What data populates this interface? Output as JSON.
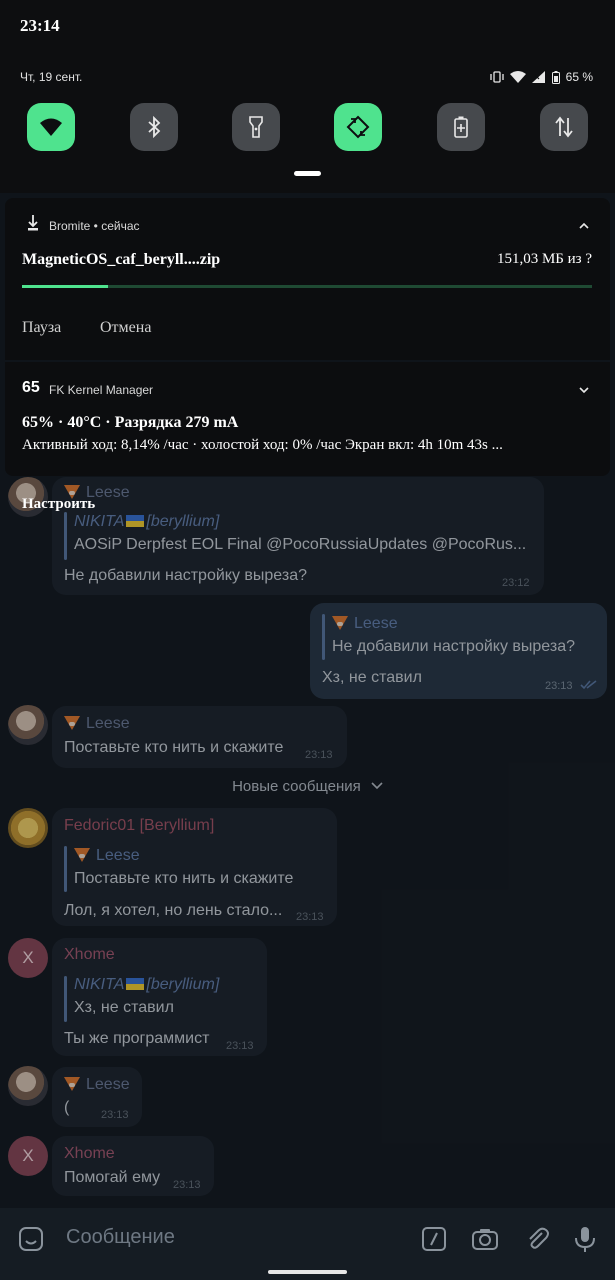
{
  "status_bar": {
    "time": "23:14",
    "date": "Чт, 19 сент.",
    "battery": "65 %"
  },
  "quick_tiles": [
    {
      "icon": "wifi-icon",
      "active": true
    },
    {
      "icon": "bluetooth-icon",
      "active": false
    },
    {
      "icon": "flashlight-icon",
      "active": false
    },
    {
      "icon": "auto-rotate-icon",
      "active": true
    },
    {
      "icon": "battery-saver-icon",
      "active": false
    },
    {
      "icon": "mobile-data-icon",
      "active": false
    }
  ],
  "download_notification": {
    "app": "Bromite • сейчас",
    "title": "MagneticOS_caf_beryll....zip",
    "size": "151,03 МБ из ?",
    "progress": 0.15,
    "actions": [
      "Пауза",
      "Отмена"
    ]
  },
  "kernel_notification": {
    "icon_text": "65",
    "app": "FK Kernel Manager",
    "title": "65% · 40°C · Разрядка 279 mA",
    "body": "Активный ход: 8,14% /час · холостой ход: 0% /час Экран вкл: 4h 10m 43s  ..."
  },
  "configure_label": "Настроить",
  "chat": {
    "messages": [
      {
        "sender": "Leese",
        "reply_name": "NIKITA",
        "reply_name_suffix": "[beryllium]",
        "reply_text": "AOSiP Derpfest EOL Final  @PocoRussiaUpdates @PocoRus...",
        "text": "Не добавили настройку выреза?",
        "time": "23:12"
      },
      {
        "reply_name": "Leese",
        "reply_text": "Не добавили настройку выреза?",
        "text": "Хз, не ставил",
        "time": "23:13"
      },
      {
        "sender": "Leese",
        "text": "Поставьте кто нить и скажите",
        "time": "23:13"
      },
      {
        "sender": "Fedoric01 [Beryllium]",
        "reply_name": "Leese",
        "reply_text": "Поставьте кто нить и скажите",
        "text": "Лол, я хотел, но лень стало...",
        "time": "23:13"
      },
      {
        "sender": "Xhome",
        "avatar": "X",
        "reply_name": "NIKITA",
        "reply_name_suffix": "[beryllium]",
        "reply_text": "Хз, не ставил",
        "text": "Ты же программист",
        "time": "23:13"
      },
      {
        "sender": "Leese",
        "text": "(",
        "time": "23:13"
      },
      {
        "sender": "Xhome",
        "avatar": "X",
        "text": "Помогай ему",
        "time": "23:13"
      }
    ],
    "new_messages_label": "Новые сообщения",
    "input_placeholder": "Сообщение"
  }
}
